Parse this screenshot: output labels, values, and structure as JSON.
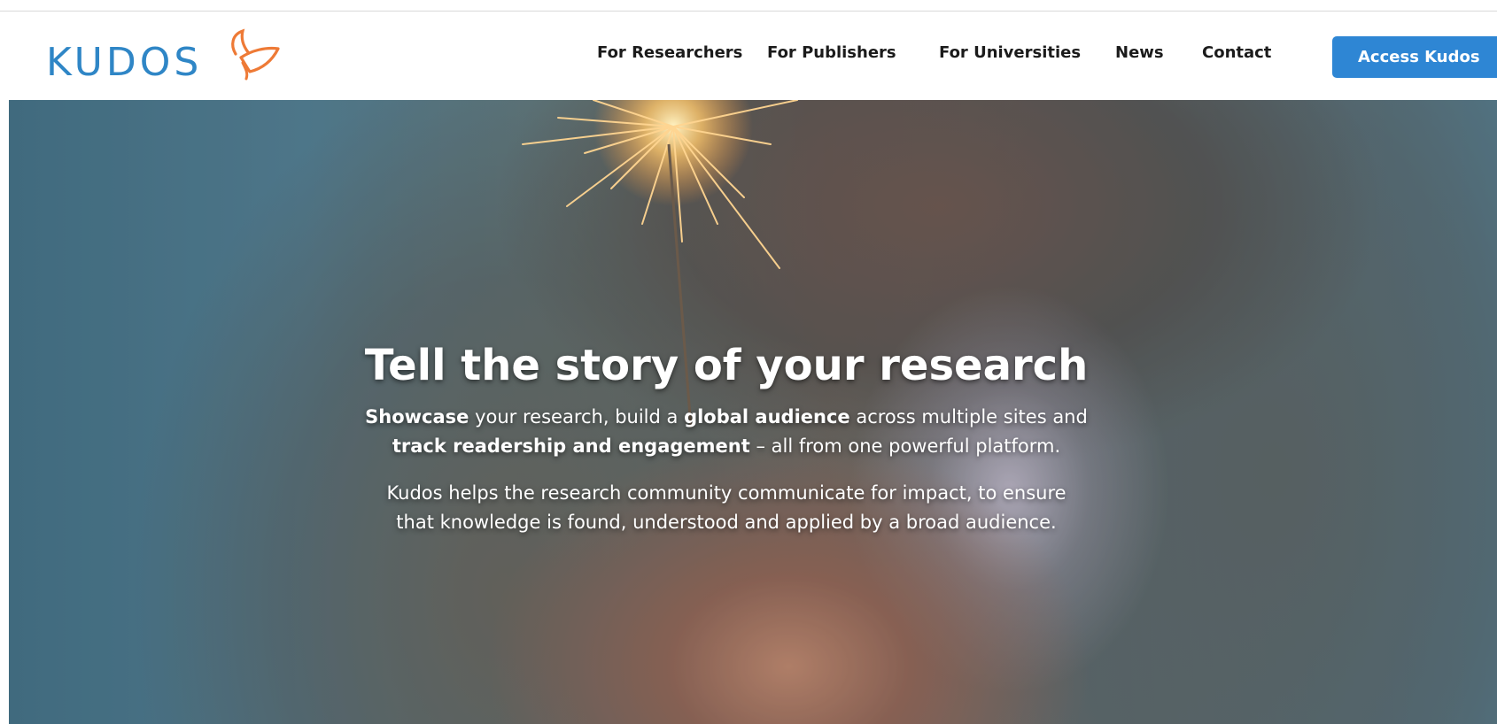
{
  "brand": {
    "name": "KUDOS",
    "color": "#2f86c6",
    "accent_color": "#ee7a36",
    "icon": "butterfly-icon"
  },
  "nav": {
    "items": [
      {
        "label": "For Researchers"
      },
      {
        "label": "For Publishers"
      },
      {
        "label": "For Universities"
      },
      {
        "label": "News"
      },
      {
        "label": "Contact"
      }
    ],
    "cta_label": "Access Kudos",
    "cta_color": "#2e86d4"
  },
  "hero": {
    "title": "Tell the story of your research",
    "sub": {
      "part1_bold": "Showcase",
      "part2": " your research, build a ",
      "part3_bold": "global audience",
      "part4": " across multiple sites and",
      "part5_bold": "track readership and engagement",
      "part6": " – all from one powerful platform."
    },
    "desc_line1": "Kudos helps the research community communicate for impact, to ensure",
    "desc_line2": "that knowledge is found, understood and applied by a broad audience."
  }
}
